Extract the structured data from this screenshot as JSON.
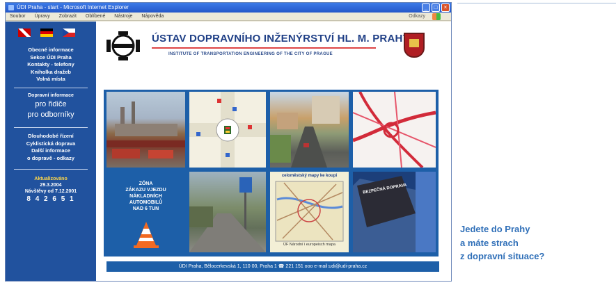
{
  "window": {
    "title": "ÚDI Praha - start - Microsoft Internet Explorer",
    "min_label": "_",
    "max_label": "□",
    "close_label": "×",
    "menu": [
      "Soubor",
      "Úpravy",
      "Zobrazit",
      "Oblíbené",
      "Nástroje",
      "Nápověda"
    ],
    "links_label": "Odkazy"
  },
  "sidebar": {
    "flags": [
      "uk-flag",
      "de-flag",
      "cz-flag"
    ],
    "menu_top": [
      "Obecné informace",
      "Sekce ÚDI Praha",
      "Kontakty - telefony",
      "Kniholka dražeb",
      "Volná místa"
    ],
    "info_header": "Dopravní informace",
    "info_drivers": "pro řidiče",
    "info_pros": "pro odborníky",
    "menu_bottom": [
      "Dlouhodobé řízení",
      "Cyklistická doprava",
      "Další informace",
      "o dopravě - odkazy"
    ],
    "updated_label": "Aktualizováno",
    "updated_date": "29.3.2004",
    "visits_label": "Návštěvy od 7.12.2001",
    "visits_count": "8 4 2 6 5 1"
  },
  "header": {
    "title": "ÚSTAV DOPRAVNÍHO INŽENÝRSTVÍ HL. M. PRAHY",
    "subtitle": "INSTITUTE OF TRANSPORTATION ENGINEERING OF THE CITY OF PRAGUE"
  },
  "tiles": {
    "zone_lines": [
      "ZÓNA",
      "ZÁKAZU VJEZDU",
      "NÁKLADNÍCH",
      "AUTOMOBILŮ",
      "NAD 6 TUN"
    ],
    "map_title": "celoměstský mapy ke koupi",
    "map_footer": "ÚF Národní i europeisch mapa",
    "tile8_label": "BEZPEČNÁ DOPRAVA"
  },
  "footer": "ÚDI Praha, Bělocerkevská 1, 110 00, Praha 1  ☎ 221 151 ooo  e-mail:udi@udi-praha.cz",
  "tagline": [
    "Jedete do Prahy",
    "a máte strach",
    "z dopravní situace?"
  ],
  "colors": {
    "sidebar_bg": "#21529e",
    "grid_bg": "#1d5fa8",
    "title_blue": "#1f3f86",
    "tagline_blue": "#2f6fb8",
    "accent_red": "#d44444"
  }
}
